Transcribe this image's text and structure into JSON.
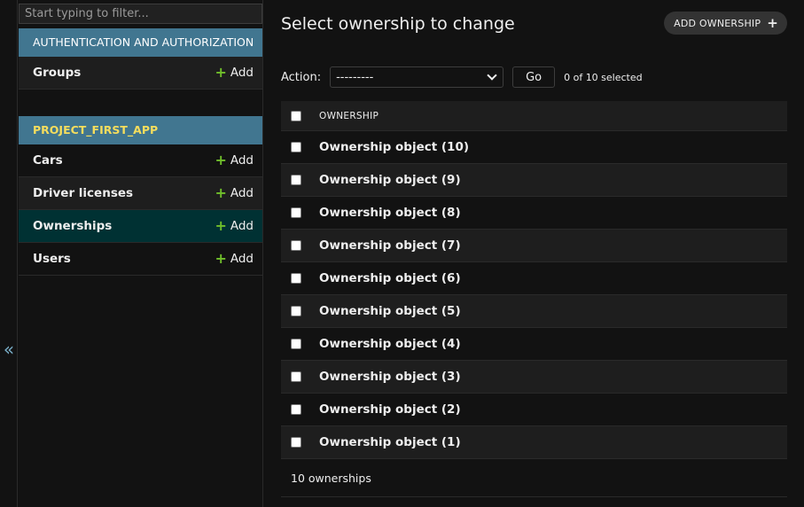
{
  "sidebar": {
    "filter_placeholder": "Start typing to filter...",
    "collapse_glyph": "«",
    "modules": [
      {
        "caption": "AUTHENTICATION AND AUTHORIZATION",
        "models": [
          {
            "name": "Groups",
            "add_label": "Add"
          }
        ]
      },
      {
        "caption": "PROJECT_FIRST_APP",
        "models": [
          {
            "name": "Cars",
            "add_label": "Add"
          },
          {
            "name": "Driver licenses",
            "add_label": "Add"
          },
          {
            "name": "Ownerships",
            "add_label": "Add",
            "current": true
          },
          {
            "name": "Users",
            "add_label": "Add"
          }
        ]
      }
    ]
  },
  "main": {
    "title": "Select ownership to change",
    "add_button_label": "ADD OWNERSHIP",
    "actions": {
      "label": "Action:",
      "selected_option": "---------",
      "go_label": "Go",
      "counter": "0 of 10 selected"
    },
    "table": {
      "column_header": "OWNERSHIP",
      "rows": [
        "Ownership object (10)",
        "Ownership object (9)",
        "Ownership object (8)",
        "Ownership object (7)",
        "Ownership object (6)",
        "Ownership object (5)",
        "Ownership object (4)",
        "Ownership object (3)",
        "Ownership object (2)",
        "Ownership object (1)"
      ]
    },
    "paginator": "10 ownerships"
  },
  "colors": {
    "caption_bg": "#417690",
    "caption_text": "#f5dd5d",
    "plus_green": "#70bf2b",
    "current_row_bg": "#003133"
  },
  "icons": {
    "collapse": "double-chevron-left-icon",
    "add": "plus-icon",
    "select": "chevron-down-icon"
  }
}
